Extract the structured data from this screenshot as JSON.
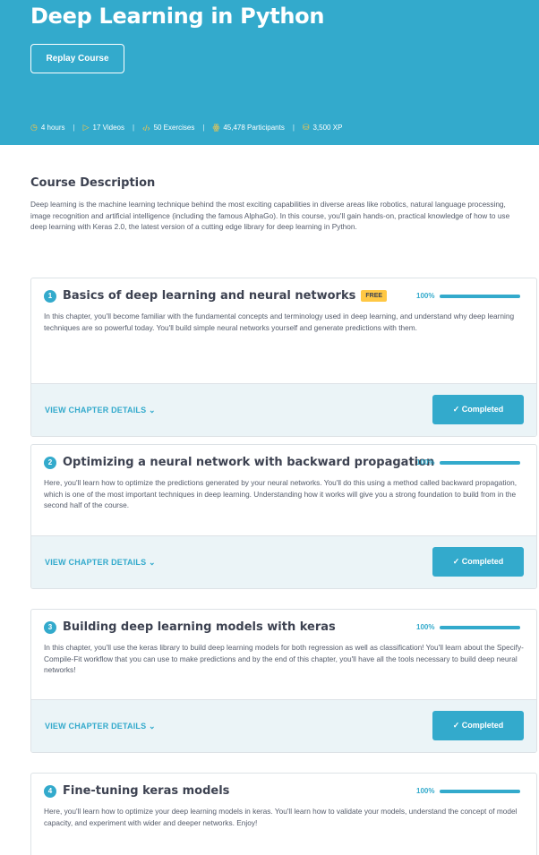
{
  "hero": {
    "title": "Deep Learning in Python",
    "replay_label": "Replay Course",
    "stats": [
      {
        "icon": "clock-icon",
        "glyph": "◷",
        "text": "4 hours"
      },
      {
        "icon": "play-icon",
        "glyph": "▷",
        "text": "17 Videos"
      },
      {
        "icon": "code-icon",
        "glyph": "‹/›",
        "text": "50 Exercises"
      },
      {
        "icon": "participants-icon",
        "glyph": "ꙮ",
        "text": "45,478 Participants"
      },
      {
        "icon": "xp-icon",
        "glyph": "⛁",
        "text": "3,500 XP"
      }
    ]
  },
  "description": {
    "title": "Course Description",
    "text": "Deep learning is the machine learning technique behind the most exciting capabilities in diverse areas like robotics, natural language processing, image recognition and artificial intelligence (including the famous AlphaGo). In this course, you'll gain hands-on, practical knowledge of how to use deep learning with Keras 2.0, the latest version of a cutting edge library for deep learning in Python."
  },
  "chapters": [
    {
      "number": "1",
      "title": "Basics of deep learning and neural networks",
      "badge": "FREE",
      "progress_label": "100%",
      "progress": 1.0,
      "text": "In this chapter, you'll become familiar with the fundamental concepts and terminology used in deep learning, and understand why deep learning techniques are so powerful today. You'll build simple neural networks yourself and generate predictions with them.",
      "details_label": "VIEW CHAPTER DETAILS ⌄",
      "status_label": "✓ Completed"
    },
    {
      "number": "2",
      "title": "Optimizing a neural network with backward propagation",
      "progress_label": "100%",
      "progress": 1.0,
      "text": "Here, you'll learn how to optimize the predictions generated by your neural networks. You'll do this using a method called backward propagation, which is one of the most important techniques in deep learning. Understanding how it works will give you a strong foundation to build from in the second half of the course.",
      "details_label": "VIEW CHAPTER DETAILS ⌄",
      "status_label": "✓ Completed"
    },
    {
      "number": "3",
      "title": "Building deep learning models with keras",
      "progress_label": "100%",
      "progress": 1.0,
      "text": "In this chapter, you'll use the keras library to build deep learning models for both regression as well as classification! You'll learn about the Specify-Compile-Fit workflow that you can use to make predictions and by the end of this chapter, you'll have all the tools necessary to build deep neural networks!",
      "details_label": "VIEW CHAPTER DETAILS ⌄",
      "status_label": "✓ Completed"
    },
    {
      "number": "4",
      "title": "Fine-tuning keras models",
      "progress_label": "100%",
      "progress": 1.0,
      "text": "Here, you'll learn how to optimize your deep learning models in keras. You'll learn how to validate your models, understand the concept of model capacity, and experiment with wider and deeper networks. Enjoy!"
    }
  ],
  "colors": {
    "accent": "#33aacc",
    "badge": "#ffc844",
    "footer": "#ebf4f7"
  }
}
